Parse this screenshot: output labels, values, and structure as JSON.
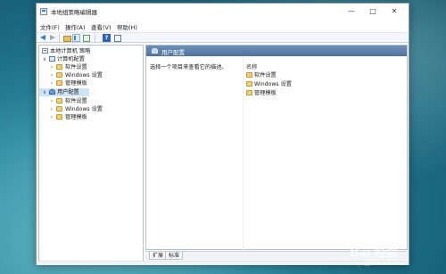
{
  "window": {
    "title": "本地组策略编辑器"
  },
  "menu": [
    "文件(F)",
    "操作(A)",
    "查看(V)",
    "帮助(H)"
  ],
  "tree": {
    "root": "本地计算机 策略",
    "computer": {
      "label": "计算机配置",
      "children": [
        "软件设置",
        "Windows 设置",
        "管理模板"
      ]
    },
    "user": {
      "label": "用户配置",
      "children": [
        "软件设置",
        "Windows 设置",
        "管理模板"
      ]
    }
  },
  "content": {
    "header": "用户配置",
    "description": "选择一个项目来查看它的描述。",
    "column_header": "名称",
    "items": [
      "软件设置",
      "Windows 设置",
      "管理模板"
    ]
  },
  "tabs": [
    "扩展",
    "标准"
  ],
  "toolbar": {
    "help_glyph": "?"
  },
  "watermark": {
    "text": "Bai 经验",
    "sub": "jingyan.baidu.com"
  },
  "colors": {
    "header_bar": "#5a7fad",
    "selection": "#cde3f7",
    "folder": "#f4cf6a"
  }
}
